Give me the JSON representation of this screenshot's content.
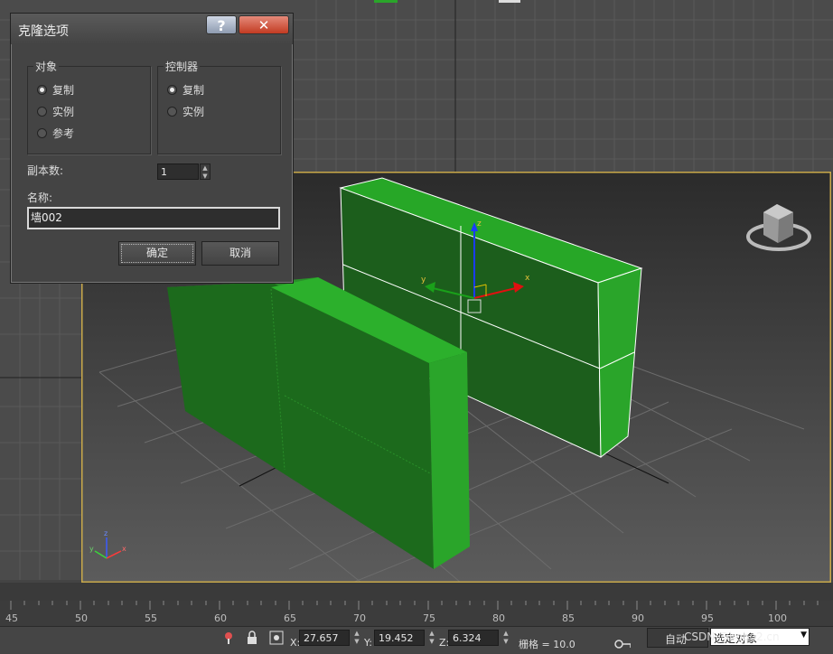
{
  "dialog": {
    "title": "克隆选项",
    "help_glyph": "?",
    "close_glyph": "✕",
    "object_group": {
      "title": "对象",
      "options": [
        "复制",
        "实例",
        "参考"
      ],
      "selected": "复制"
    },
    "controller_group": {
      "title": "控制器",
      "options": [
        "复制",
        "实例"
      ],
      "selected": "复制"
    },
    "copies_label": "副本数:",
    "copies_value": "1",
    "name_label": "名称:",
    "name_value": "墙002",
    "ok_label": "确定",
    "cancel_label": "取消"
  },
  "timeline": {
    "ticks": [
      "45",
      "50",
      "55",
      "60",
      "65",
      "70",
      "75",
      "80",
      "85",
      "90",
      "95",
      "100"
    ]
  },
  "status": {
    "x_label": "X:",
    "x_value": "27.657",
    "y_label": "Y:",
    "y_value": "19.452",
    "z_label": "Z:",
    "z_value": "6.324",
    "grid_text": "栅格 = 10.0",
    "auto_label": "自动",
    "selection_value": "选定对象",
    "watermark": "CSDN @bobo2.cn"
  },
  "axis_tripod": {
    "x": "x",
    "y": "y",
    "z": "z"
  },
  "colors": {
    "object_green": "#1f6e1f",
    "object_green_light": "#2aa52a",
    "viewport_border": "#c9a94a"
  }
}
